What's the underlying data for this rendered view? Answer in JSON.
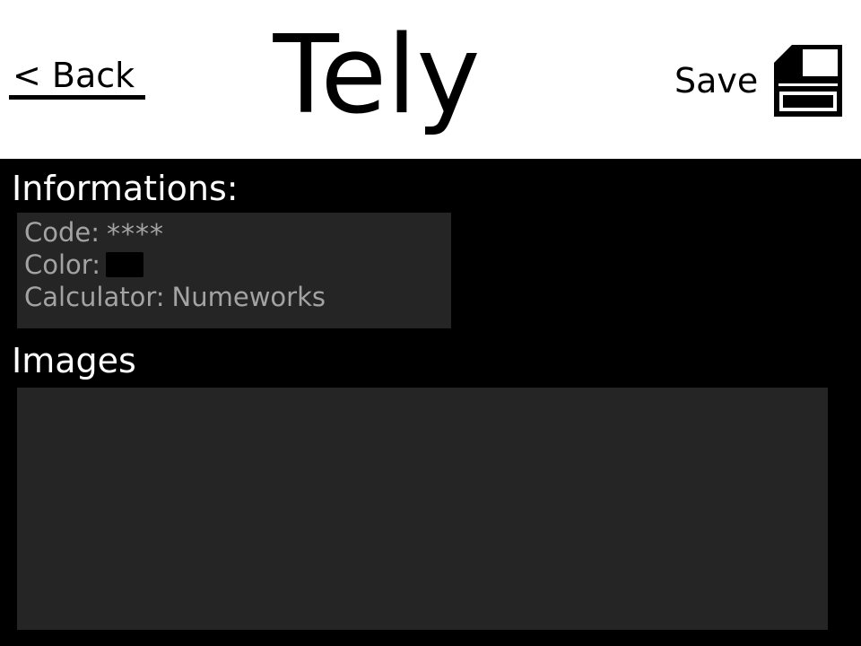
{
  "header": {
    "back_label": "< Back",
    "title": "Tely",
    "save_label": "Save",
    "save_icon": "floppy-disk-icon"
  },
  "informations": {
    "title": "Informations:",
    "code_label": "Code:",
    "code_value": "****",
    "color_label": "Color:",
    "color_value": "#000000",
    "calculator_label": "Calculator:",
    "calculator_value": "Numeworks"
  },
  "images": {
    "title": "Images"
  },
  "colors": {
    "header_bg": "#ffffff",
    "page_bg": "#000000",
    "panel_bg": "#252525",
    "panel_text": "#a3a3a3",
    "section_text": "#ffffff"
  }
}
